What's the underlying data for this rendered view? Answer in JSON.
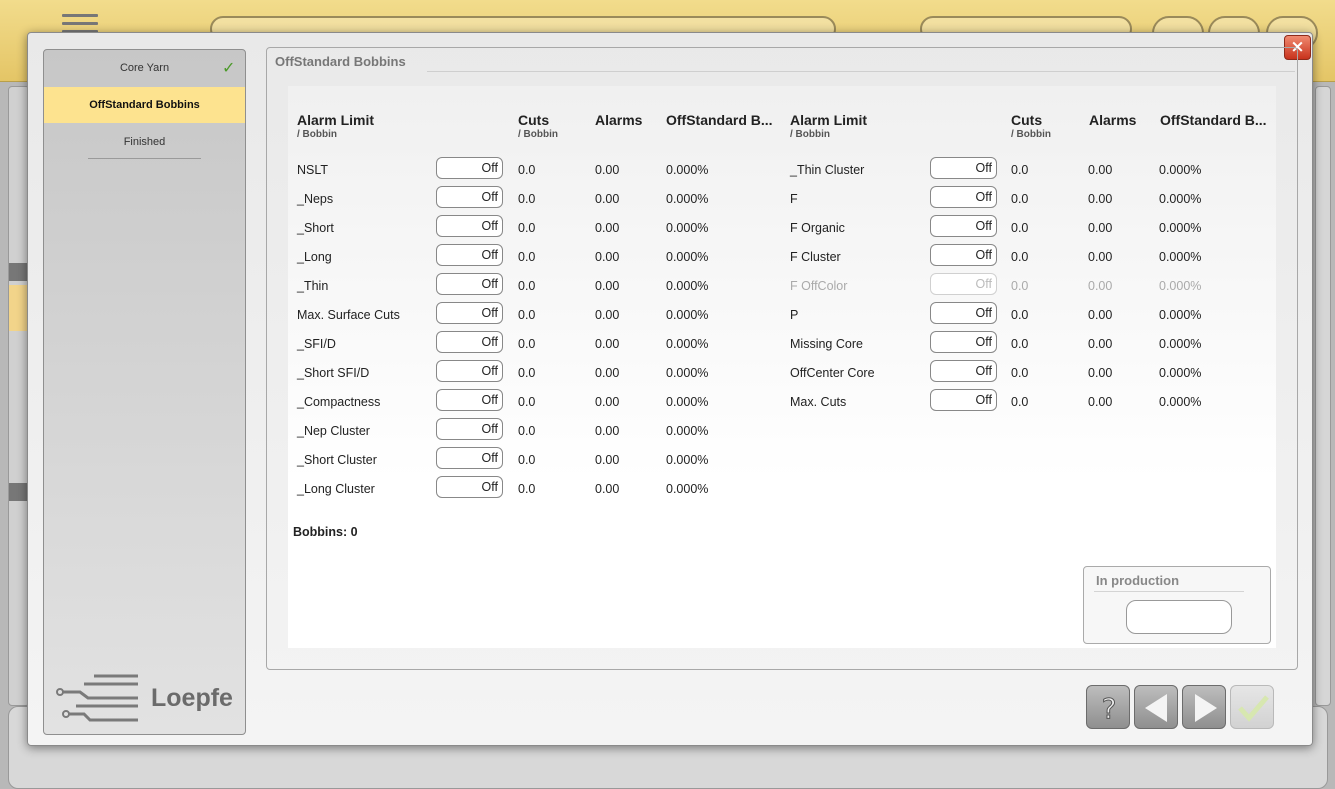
{
  "header": {
    "title": "OffStandard Bobbins"
  },
  "close_label": "×",
  "sidebar": {
    "steps": [
      {
        "label": "Core Yarn",
        "done": true
      },
      {
        "label": "OffStandard Bobbins",
        "active": true
      },
      {
        "label": "Finished"
      }
    ],
    "logo_text": "Loepfe"
  },
  "table": {
    "columns": {
      "alarm_limit": "Alarm Limit",
      "per_bobbin": "/ Bobbin",
      "cuts": "Cuts",
      "alarms": "Alarms",
      "offstandard": "OffStandard B..."
    },
    "left_rows": [
      {
        "name": "NSLT",
        "limit": "Off",
        "cuts": "0.0",
        "alarms": "0.00",
        "pct": "0.000%"
      },
      {
        "name": "_Neps",
        "limit": "Off",
        "cuts": "0.0",
        "alarms": "0.00",
        "pct": "0.000%"
      },
      {
        "name": "_Short",
        "limit": "Off",
        "cuts": "0.0",
        "alarms": "0.00",
        "pct": "0.000%"
      },
      {
        "name": "_Long",
        "limit": "Off",
        "cuts": "0.0",
        "alarms": "0.00",
        "pct": "0.000%"
      },
      {
        "name": "_Thin",
        "limit": "Off",
        "cuts": "0.0",
        "alarms": "0.00",
        "pct": "0.000%"
      },
      {
        "name": "Max. Surface Cuts",
        "limit": "Off",
        "cuts": "0.0",
        "alarms": "0.00",
        "pct": "0.000%"
      },
      {
        "name": "_SFI/D",
        "limit": "Off",
        "cuts": "0.0",
        "alarms": "0.00",
        "pct": "0.000%"
      },
      {
        "name": "_Short SFI/D",
        "limit": "Off",
        "cuts": "0.0",
        "alarms": "0.00",
        "pct": "0.000%"
      },
      {
        "name": "_Compactness",
        "limit": "Off",
        "cuts": "0.0",
        "alarms": "0.00",
        "pct": "0.000%"
      },
      {
        "name": "_Nep Cluster",
        "limit": "Off",
        "cuts": "0.0",
        "alarms": "0.00",
        "pct": "0.000%"
      },
      {
        "name": "_Short Cluster",
        "limit": "Off",
        "cuts": "0.0",
        "alarms": "0.00",
        "pct": "0.000%"
      },
      {
        "name": "_Long Cluster",
        "limit": "Off",
        "cuts": "0.0",
        "alarms": "0.00",
        "pct": "0.000%"
      }
    ],
    "right_rows": [
      {
        "name": "_Thin Cluster",
        "limit": "Off",
        "cuts": "0.0",
        "alarms": "0.00",
        "pct": "0.000%"
      },
      {
        "name": "F",
        "limit": "Off",
        "cuts": "0.0",
        "alarms": "0.00",
        "pct": "0.000%"
      },
      {
        "name": "F Organic",
        "limit": "Off",
        "cuts": "0.0",
        "alarms": "0.00",
        "pct": "0.000%"
      },
      {
        "name": "F Cluster",
        "limit": "Off",
        "cuts": "0.0",
        "alarms": "0.00",
        "pct": "0.000%"
      },
      {
        "name": "F OffColor",
        "limit": "Off",
        "cuts": "0.0",
        "alarms": "0.00",
        "pct": "0.000%",
        "disabled": true
      },
      {
        "name": "P",
        "limit": "Off",
        "cuts": "0.0",
        "alarms": "0.00",
        "pct": "0.000%"
      },
      {
        "name": "Missing Core",
        "limit": "Off",
        "cuts": "0.0",
        "alarms": "0.00",
        "pct": "0.000%"
      },
      {
        "name": "OffCenter Core",
        "limit": "Off",
        "cuts": "0.0",
        "alarms": "0.00",
        "pct": "0.000%"
      },
      {
        "name": "Max. Cuts",
        "limit": "Off",
        "cuts": "0.0",
        "alarms": "0.00",
        "pct": "0.000%"
      }
    ]
  },
  "bobbins": "Bobbins:  0",
  "in_production": {
    "title": "In production",
    "value": ""
  },
  "nav": {
    "help": "?"
  },
  "colors": {
    "active_step": "#fde38f",
    "close": "#c8321c",
    "check": "#4c9a2a"
  }
}
